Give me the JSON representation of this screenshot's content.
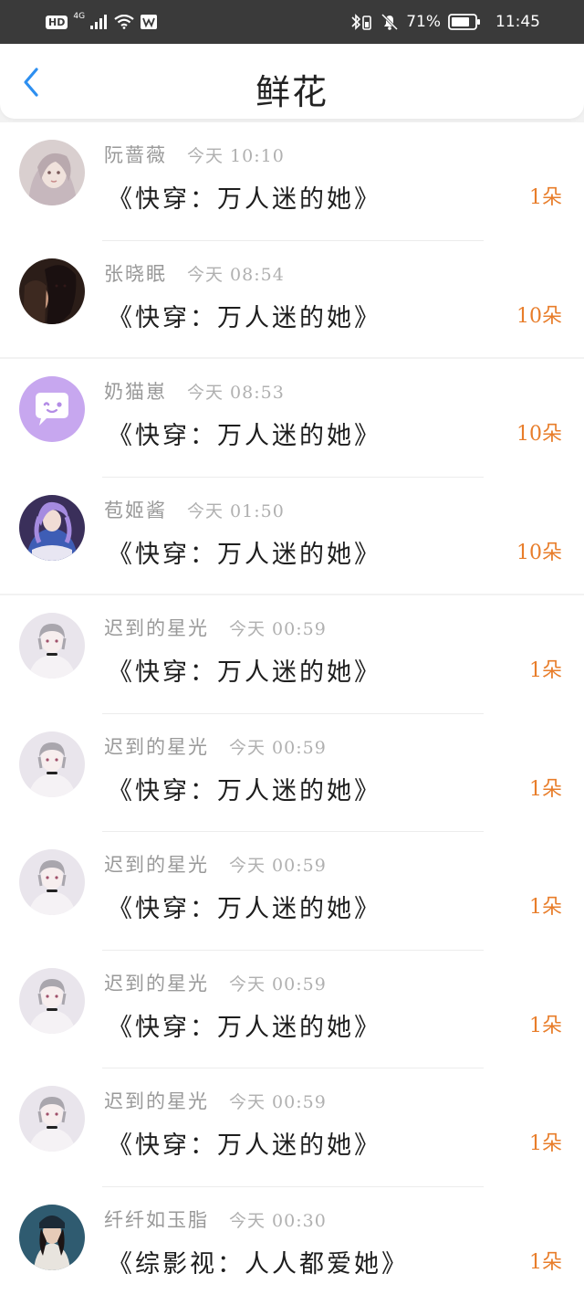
{
  "status_bar": {
    "hd": "HD",
    "network": "4G",
    "battery_percent": "71%",
    "time": "11:45"
  },
  "nav": {
    "title": "鲜花",
    "back_icon": "chevron-left-icon"
  },
  "colors": {
    "accent_blue": "#2d8ff0",
    "count_orange": "#e87d2a",
    "name_gray": "#999999",
    "time_gray": "#b0b0b0"
  },
  "rows": [
    {
      "name": "阮蔷薇",
      "time": "今天 10:10",
      "book": "《快穿：万人迷的她》",
      "count": "1朵"
    },
    {
      "name": "张晓眠",
      "time": "今天 08:54",
      "book": "《快穿：万人迷的她》",
      "count": "10朵"
    },
    {
      "name": "奶猫崽",
      "time": "今天 08:53",
      "book": "《快穿：万人迷的她》",
      "count": "10朵"
    },
    {
      "name": "苞姬酱",
      "time": "今天 01:50",
      "book": "《快穿：万人迷的她》",
      "count": "10朵"
    },
    {
      "name": "迟到的星光",
      "time": "今天 00:59",
      "book": "《快穿：万人迷的她》",
      "count": "1朵"
    },
    {
      "name": "迟到的星光",
      "time": "今天 00:59",
      "book": "《快穿：万人迷的她》",
      "count": "1朵"
    },
    {
      "name": "迟到的星光",
      "time": "今天 00:59",
      "book": "《快穿：万人迷的她》",
      "count": "1朵"
    },
    {
      "name": "迟到的星光",
      "time": "今天 00:59",
      "book": "《快穿：万人迷的她》",
      "count": "1朵"
    },
    {
      "name": "迟到的星光",
      "time": "今天 00:59",
      "book": "《快穿：万人迷的她》",
      "count": "1朵"
    },
    {
      "name": "纤纤如玉脂",
      "time": "今天 00:30",
      "book": "《综影视：人人都爱她》",
      "count": "1朵"
    }
  ]
}
